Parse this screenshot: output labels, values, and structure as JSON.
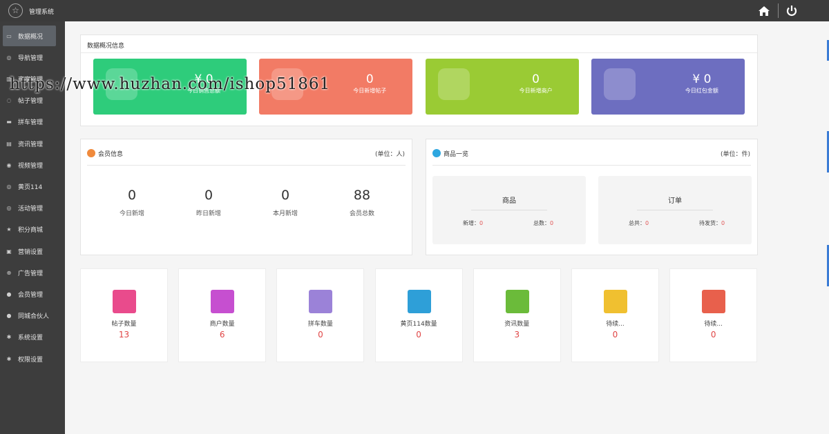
{
  "app": {
    "title": "管理系统"
  },
  "sidebar": {
    "items": [
      {
        "label": "数据概况",
        "icon": "monitor-icon"
      },
      {
        "label": "导航管理",
        "icon": "circle-icon"
      },
      {
        "label": "商家管理",
        "icon": "bank-icon"
      },
      {
        "label": "帖子管理",
        "icon": "comment-icon"
      },
      {
        "label": "拼车管理",
        "icon": "car-icon"
      },
      {
        "label": "资讯管理",
        "icon": "news-icon"
      },
      {
        "label": "视频管理",
        "icon": "video-icon"
      },
      {
        "label": "黄页114",
        "icon": "phone-icon"
      },
      {
        "label": "活动管理",
        "icon": "calendar-icon"
      },
      {
        "label": "积分商城",
        "icon": "star-icon"
      },
      {
        "label": "营销设置",
        "icon": "gift-icon"
      },
      {
        "label": "广告管理",
        "icon": "globe-icon"
      },
      {
        "label": "会员管理",
        "icon": "user-icon"
      },
      {
        "label": "同城合伙人",
        "icon": "group-icon"
      },
      {
        "label": "系统设置",
        "icon": "gear-icon"
      },
      {
        "label": "权限设置",
        "icon": "gear-icon"
      }
    ]
  },
  "overview": {
    "title": "数据概况信息",
    "cards": [
      {
        "value": "¥ 0",
        "label": "今日销售总额",
        "color": "#2ecc7b",
        "icon": "money-bag-icon"
      },
      {
        "value": "0",
        "label": "今日新增帖子",
        "color": "#f27b65",
        "icon": "book-icon"
      },
      {
        "value": "0",
        "label": "今日新增商户",
        "color": "#9acb34",
        "icon": "chat-bubble-icon"
      },
      {
        "value": "¥ 0",
        "label": "今日红包金额",
        "color": "#6d6ec0",
        "icon": "paw-icon"
      }
    ]
  },
  "member": {
    "title": "会员信息",
    "unit": "(单位：人)",
    "stats": [
      {
        "value": "0",
        "label": "今日新增"
      },
      {
        "value": "0",
        "label": "昨日新增"
      },
      {
        "value": "0",
        "label": "本月新增"
      },
      {
        "value": "88",
        "label": "会员总数"
      }
    ]
  },
  "goods": {
    "title": "商品一览",
    "unit": "(单位：件)",
    "boxes": [
      {
        "title": "商品",
        "left_label": "新增：",
        "left_value": "0",
        "right_label": "总数：",
        "right_value": "0"
      },
      {
        "title": "订单",
        "left_label": "总共：",
        "left_value": "0",
        "right_label": "待发货：",
        "right_value": "0"
      }
    ]
  },
  "tiles": [
    {
      "label": "帖子数量",
      "value": "13",
      "color": "#e94b8c",
      "icon": "document-icon"
    },
    {
      "label": "商户数量",
      "value": "6",
      "color": "#c64fd0",
      "icon": "money-bag-icon"
    },
    {
      "label": "拼车数量",
      "value": "0",
      "color": "#9b82d8",
      "icon": "truck-icon"
    },
    {
      "label": "黄页114数量",
      "value": "0",
      "color": "#2e9fd8",
      "icon": "clipboard-icon"
    },
    {
      "label": "资讯数量",
      "value": "3",
      "color": "#6bbb3a",
      "icon": "notebook-icon"
    },
    {
      "label": "待续...",
      "value": "0",
      "color": "#f0c030",
      "icon": "cart-icon"
    },
    {
      "label": "待续...",
      "value": "0",
      "color": "#e8604c",
      "icon": "coin-icon"
    }
  ],
  "watermark": "https://www.huzhan.com/ishop51861"
}
